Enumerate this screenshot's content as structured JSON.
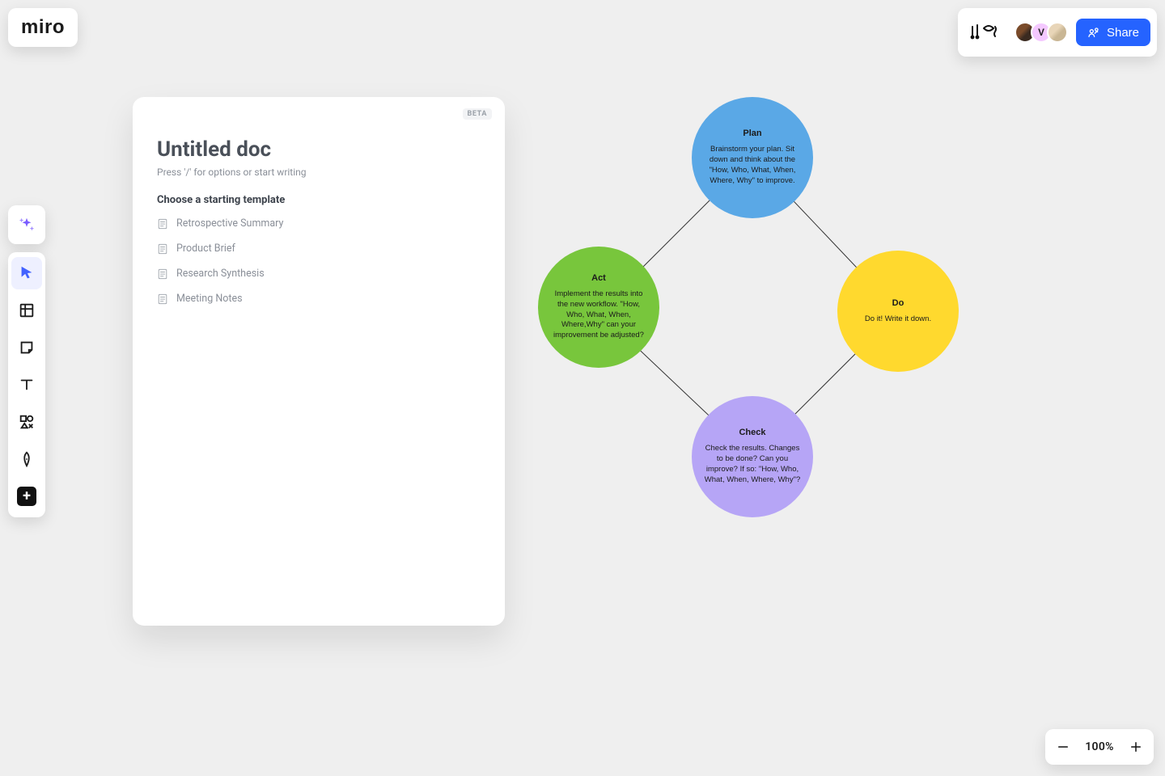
{
  "app": {
    "logo_text": "miro"
  },
  "header": {
    "reactions": [
      "♪",
      "♩",
      "♫"
    ],
    "avatar_letter": "V",
    "share_label": "Share"
  },
  "toolbar": {
    "items": [
      {
        "name": "sparkle-icon"
      },
      {
        "name": "cursor-icon",
        "active": true
      },
      {
        "name": "frame-icon"
      },
      {
        "name": "sticky-icon"
      },
      {
        "name": "text-icon"
      },
      {
        "name": "shapes-icon"
      },
      {
        "name": "pen-icon"
      },
      {
        "name": "add-icon"
      }
    ]
  },
  "doc": {
    "beta_label": "BETA",
    "title": "Untitled doc",
    "hint": "Press '/' for options or start writing",
    "section_label": "Choose a starting template",
    "templates": [
      "Retrospective Summary",
      "Product Brief",
      "Research Synthesis",
      "Meeting Notes"
    ]
  },
  "diagram": {
    "nodes": {
      "plan": {
        "title": "Plan",
        "body": "Brainstorm your plan. Sit down and think about the \"How, Who, What, When, Where, Why\" to improve."
      },
      "do": {
        "title": "Do",
        "body": "Do it! Write it down."
      },
      "check": {
        "title": "Check",
        "body": "Check the results. Changes to be done? Can you improve? If so: \"How, Who, What, When, Where, Why\"?"
      },
      "act": {
        "title": "Act",
        "body": "Implement the results into the new workflow. \"How, Who, What, When, Where,Why\" can your improvement be adjusted?"
      }
    }
  },
  "zoom": {
    "level": "100%"
  },
  "colors": {
    "blue": "#5aa8e6",
    "yellow": "#ffd92e",
    "purple": "#b6a5f6",
    "green": "#78c63c",
    "accent": "#2563ff"
  },
  "chart_data": {
    "type": "diagram",
    "layout": "diamond-cycle",
    "nodes": [
      {
        "id": "plan",
        "label": "Plan",
        "position": "top",
        "color": "#5aa8e6",
        "text": "Brainstorm your plan. Sit down and think about the \"How, Who, What, When, Where, Why\" to improve."
      },
      {
        "id": "do",
        "label": "Do",
        "position": "right",
        "color": "#ffd92e",
        "text": "Do it! Write it down."
      },
      {
        "id": "check",
        "label": "Check",
        "position": "bottom",
        "color": "#b6a5f6",
        "text": "Check the results. Changes to be done? Can you improve? If so: \"How, Who, What, When, Where, Why\"?"
      },
      {
        "id": "act",
        "label": "Act",
        "position": "left",
        "color": "#78c63c",
        "text": "Implement the results into the new workflow. \"How, Who, What, When, Where,Why\" can your improvement be adjusted?"
      }
    ],
    "edges": [
      [
        "plan",
        "do"
      ],
      [
        "do",
        "check"
      ],
      [
        "check",
        "act"
      ],
      [
        "act",
        "plan"
      ]
    ]
  }
}
